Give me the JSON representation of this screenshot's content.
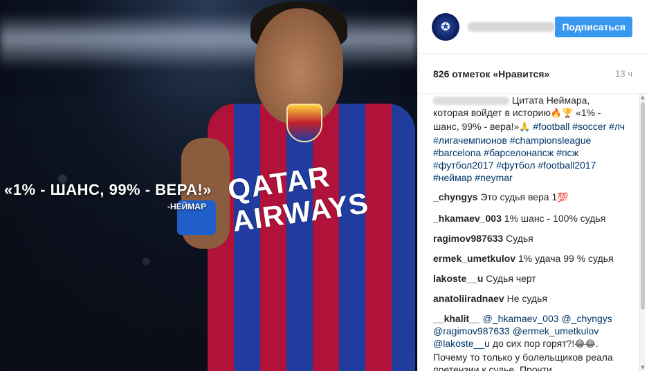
{
  "photo": {
    "quote": "«1% - ШАНС, 99% - ВЕРА!»",
    "author": "-НЕЙМАР",
    "sponsor": "QATAR AIRWAYS"
  },
  "header": {
    "avatar_icon": "champions-league-star-icon",
    "follow_label": "Подписаться"
  },
  "likes": {
    "text": "826 отметок «Нравится»",
    "time": "13 ч"
  },
  "caption": {
    "text_start": "Цитата Неймара, которая войдет в историю",
    "emoji_1": "🔥🏆",
    "text_mid": " «1% - шанс, 99% - вера!»",
    "emoji_2": "🙏",
    "tags": [
      "#football",
      "#soccer",
      "#лч",
      "#лигачемпионов",
      "#championsleague",
      "#barcelona",
      "#барселонапсж",
      "#псж",
      "#футбол2017",
      "#футбол",
      "#football2017",
      "#неймар",
      "#neymar"
    ]
  },
  "comments": [
    {
      "user": "_chyngys",
      "text": "Это судья вера 1",
      "emoji": "💯"
    },
    {
      "user": "_hkamaev_003",
      "text": "1% шанс - 100% судья"
    },
    {
      "user": "ragimov987633",
      "text": "Судья"
    },
    {
      "user": "ermek_umetkulov",
      "text": "1% удача 99 % судья"
    },
    {
      "user": "lakoste__u",
      "text": "Судья черт"
    },
    {
      "user": "anatoliiradnaev",
      "text": "Не судья"
    }
  ],
  "last_comment": {
    "user": "__khalit__",
    "mentions": [
      "@_hkamaev_003",
      "@_chyngys",
      "@ragimov987633",
      "@ermek_umetkulov",
      "@lakoste__u"
    ],
    "text_1": " до сих пор горят?!",
    "emoji": "😂😂",
    "text_2": ". Почему то только у болельщиков реала претензии к судье. Прочти"
  },
  "scrollbar": {
    "up_icon": "▲",
    "down_icon": "▼"
  }
}
